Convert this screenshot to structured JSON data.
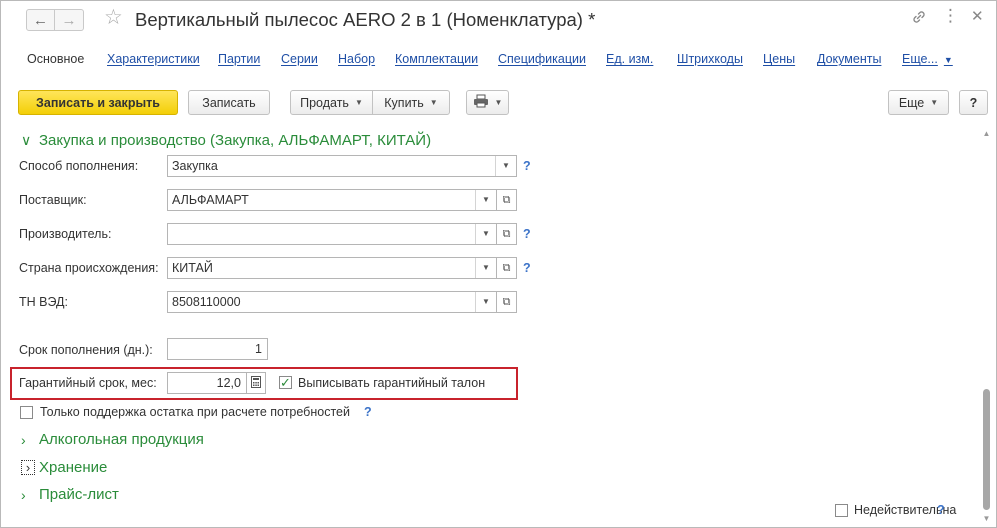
{
  "window": {
    "title": "Вертикальный пылесос AERO 2 в 1 (Номенклатура) *"
  },
  "tabs": {
    "main": "Основное",
    "characteristics": "Характеристики",
    "batches": "Партии",
    "series": "Серии",
    "set": "Набор",
    "kits": "Комплектации",
    "specifications": "Спецификации",
    "units": "Ед. изм.",
    "barcodes": "Штрихкоды",
    "prices": "Цены",
    "documents": "Документы",
    "more": "Еще..."
  },
  "toolbar": {
    "save_close": "Записать и закрыть",
    "save": "Записать",
    "sell": "Продать",
    "buy": "Купить",
    "print_icon": "printer-icon",
    "more": "Еще",
    "help": "?"
  },
  "sections": {
    "purchase": "Закупка и производство (Закупка, АЛЬФАМАРТ, КИТАЙ)",
    "alcohol": "Алкогольная продукция",
    "storage": "Хранение",
    "pricelist": "Прайс-лист"
  },
  "form": {
    "replenishment_method": {
      "label": "Способ пополнения:",
      "value": "Закупка"
    },
    "supplier": {
      "label": "Поставщик:",
      "value": "АЛЬФАМАРТ"
    },
    "manufacturer": {
      "label": "Производитель:",
      "value": ""
    },
    "country": {
      "label": "Страна происхождения:",
      "value": "КИТАЙ"
    },
    "tnved": {
      "label": "ТН ВЭД:",
      "value": "8508110000"
    },
    "replenishment_days": {
      "label": "Срок пополнения (дн.):",
      "value": "1"
    },
    "warranty": {
      "label": "Гарантийный срок, мес:",
      "value": "12,0",
      "checkbox_label": "Выписывать гарантийный талон",
      "checked": true
    },
    "only_support": {
      "label": "Только поддержка остатка при расчете потребностей",
      "checked": false
    },
    "invalid": {
      "label": "Недействительна",
      "checked": false
    },
    "help_mark": "?"
  },
  "colors": {
    "accent_green": "#2a8c3a",
    "link_blue": "#1f4fa6",
    "primary_yellow": "#f3cf07",
    "highlight_red": "#c8232c"
  }
}
